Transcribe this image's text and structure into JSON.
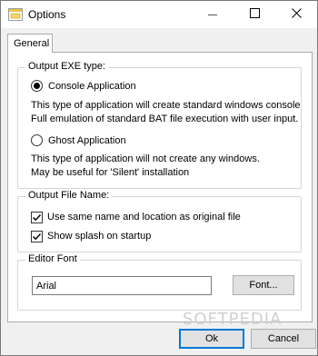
{
  "window": {
    "title": "Options",
    "minimize_glyph": "—",
    "icons": [
      "app-icon",
      "minimize-icon",
      "maximize-icon",
      "close-icon"
    ]
  },
  "tabs": [
    {
      "label": "General",
      "selected": true
    }
  ],
  "output_exe": {
    "legend": "Output EXE type:",
    "options": [
      {
        "label": "Console Application",
        "selected": true,
        "desc": [
          "This type of application will create standard windows console",
          "Full emulation of standard BAT file execution with user input."
        ]
      },
      {
        "label": "Ghost Application",
        "selected": false,
        "desc": [
          "This type of application will not create any windows.",
          "May be useful for 'Silent' installation"
        ]
      }
    ]
  },
  "output_file": {
    "legend": "Output File Name:",
    "checks": [
      {
        "label": "Use same name and location as original file",
        "checked": true
      },
      {
        "label": "Show splash on startup",
        "checked": true
      }
    ]
  },
  "editor_font": {
    "legend": "Editor Font",
    "value": "Arial",
    "button_label": "Font..."
  },
  "footer": {
    "ok_label": "Ok",
    "cancel_label": "Cancel"
  },
  "watermark": "SOFTPEDIA",
  "colors": {
    "accent": "#0078d7",
    "button_face": "#e1e1e1",
    "group_border": "#d5d5d5"
  }
}
